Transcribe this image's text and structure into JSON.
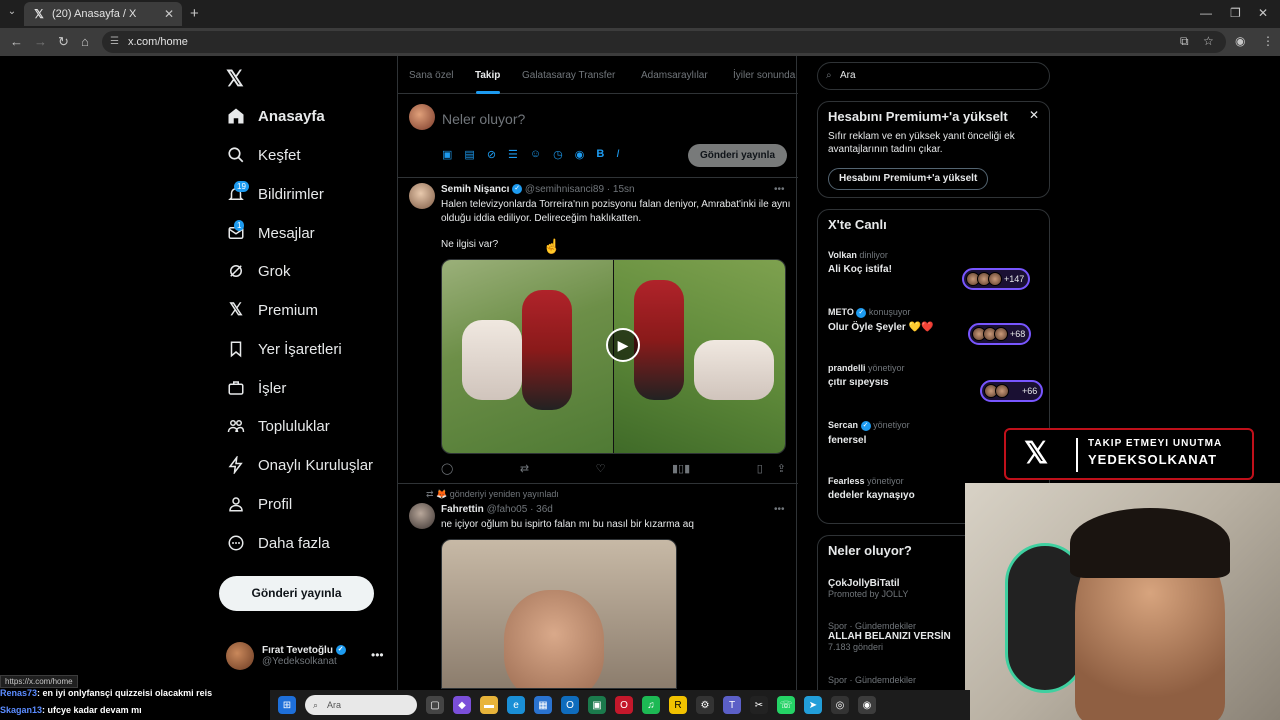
{
  "browser": {
    "tab_title": "(20) Anasayfa / X",
    "url": "x.com/home",
    "status_url": "https://x.com/home"
  },
  "nav": {
    "items": [
      {
        "label": "Anasayfa",
        "icon": "home-icon"
      },
      {
        "label": "Keşfet",
        "icon": "search-icon"
      },
      {
        "label": "Bildirimler",
        "icon": "bell-icon",
        "badge": "19"
      },
      {
        "label": "Mesajlar",
        "icon": "mail-icon",
        "badge": "1"
      },
      {
        "label": "Grok",
        "icon": "grok-icon"
      },
      {
        "label": "Premium",
        "icon": "x-icon"
      },
      {
        "label": "Yer İşaretleri",
        "icon": "bookmark-icon"
      },
      {
        "label": "İşler",
        "icon": "briefcase-icon"
      },
      {
        "label": "Topluluklar",
        "icon": "people-icon"
      },
      {
        "label": "Onaylı Kuruluşlar",
        "icon": "lightning-icon"
      },
      {
        "label": "Profil",
        "icon": "user-icon"
      },
      {
        "label": "Daha fazla",
        "icon": "more-circle-icon"
      }
    ],
    "post_button": "Gönderi yayınla",
    "account": {
      "name": "Fırat Tevetoğlu",
      "handle": "@Yedeksolkanat"
    }
  },
  "timeline": {
    "tabs": [
      "Sana özel",
      "Takip",
      "Galatasaray Transfer",
      "Adamsaraylılar",
      "İyiler sonunda"
    ],
    "composer_placeholder": "Neler oluyor?",
    "composer_button": "Gönderi yayınla",
    "tweet1": {
      "name": "Semih Nişancı",
      "handle": "@semihnisanci89 · 15sn",
      "text": "Halen televizyonlarda Torreira'nın pozisyonu falan deniyor, Amrabat'inki ile aynı olduğu iddia ediliyor. Delireceğim haklıkatten.",
      "text2": "Ne ilgisi var?"
    },
    "tweet2": {
      "retweet_note": "🦊 gönderiyi yeniden yayınladı",
      "name": "Fahrettin",
      "handle": "@faho05 · 36d",
      "text": "ne içiyor oğlum bu ispirto falan mı bu nasıl bir kızarma aq"
    }
  },
  "right": {
    "search_placeholder": "Ara",
    "premium": {
      "title": "Hesabını Premium+'a yükselt",
      "text": "Sıfır reklam ve en yüksek yanıt önceliği ek avantajlarının tadını çıkar.",
      "button": "Hesabını Premium+'a yükselt"
    },
    "live": {
      "title": "X'te Canlı",
      "items": [
        {
          "who": "Volkan",
          "status": "dinliyor",
          "title": "Ali Koç istifa!",
          "count": "+147"
        },
        {
          "who": "METO",
          "status": "konuşuyor",
          "title": "Olur Öyle Şeyler 💛❤️",
          "count": "+68"
        },
        {
          "who": "prandelli",
          "status": "yönetiyor",
          "title": "çıtır sıpeysıs",
          "count": "+66"
        },
        {
          "who": "Sercan",
          "status": "yönetiyor",
          "title": "fenersel",
          "count": ""
        },
        {
          "who": "Fearless",
          "status": "yönetiyor",
          "title": "dedeler kaynaşıyo",
          "count": ""
        }
      ]
    },
    "trends": {
      "title": "Neler oluyor?",
      "items": [
        {
          "meta": "",
          "name": "ÇokJollyBiTatil",
          "sub": "Promoted by JOLLY"
        },
        {
          "meta": "Spor · Gündemdekiler",
          "name": "ALLAH BELANIZI VERSİN",
          "sub": "7.183 gönderi"
        },
        {
          "meta": "Spor · Gündemdekiler",
          "name": "",
          "sub": ""
        }
      ]
    }
  },
  "overlay": {
    "line1": "TAKIP ETMEYI UNUTMA",
    "line2": "YEDEKSOLKANAT"
  },
  "chat": [
    {
      "user": "Renas73",
      "msg": ": en iyi onlyfansçi quizzeisi olacakmi reis"
    },
    {
      "user": "Skagan13",
      "msg": ": ufcye kadar devam mı"
    }
  ],
  "taskbar": {
    "search_placeholder": "Ara"
  }
}
